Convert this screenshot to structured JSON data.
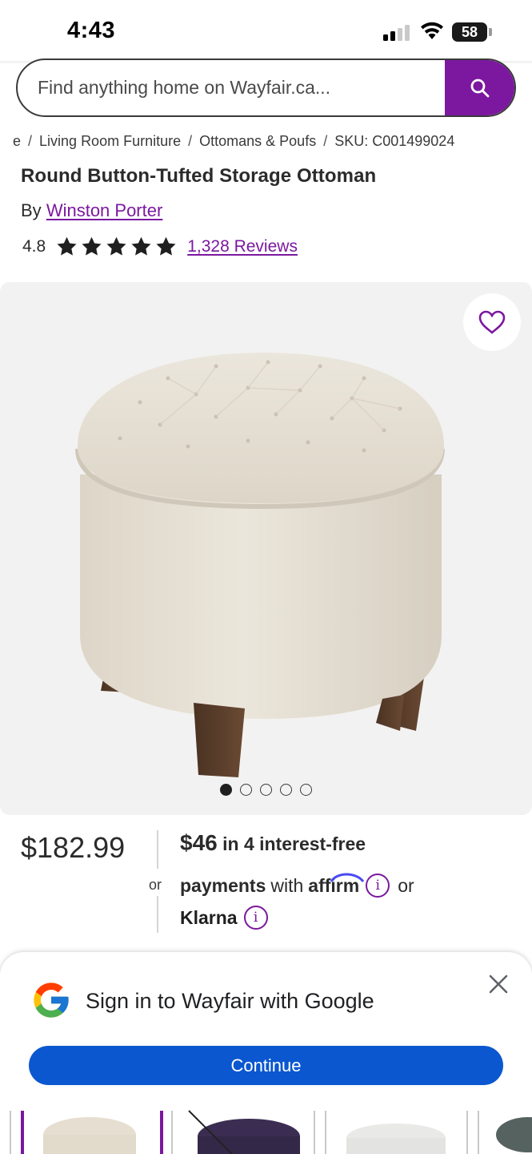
{
  "status_bar": {
    "time": "4:43",
    "battery": "58"
  },
  "search": {
    "placeholder": "Find anything home on Wayfair.ca..."
  },
  "breadcrumb": {
    "items": [
      "e",
      "Living Room Furniture",
      "Ottomans & Poufs",
      "SKU: C001499024"
    ],
    "separator": "/"
  },
  "product": {
    "title": "Round Button-Tufted Storage Ottoman",
    "by_label": "By",
    "brand": "Winston Porter",
    "rating": "4.8",
    "stars": 5,
    "reviews": "1,328 Reviews"
  },
  "gallery": {
    "image_count": 5,
    "active_index": 0
  },
  "pricing": {
    "price": "$182.99",
    "or_label": "or",
    "installment_amount": "$46",
    "installment_text": "in 4 interest-free",
    "payments_label": "payments",
    "with_label": "with",
    "affirm": "affirm",
    "or_after": "or",
    "klarna": "Klarna"
  },
  "google_sheet": {
    "title": "Sign in to Wayfair with Google",
    "continue_label": "Continue"
  },
  "colors": {
    "brand_purple": "#7b189f",
    "google_blue": "#0b57d0",
    "image_bg": "#f3f2f2"
  }
}
